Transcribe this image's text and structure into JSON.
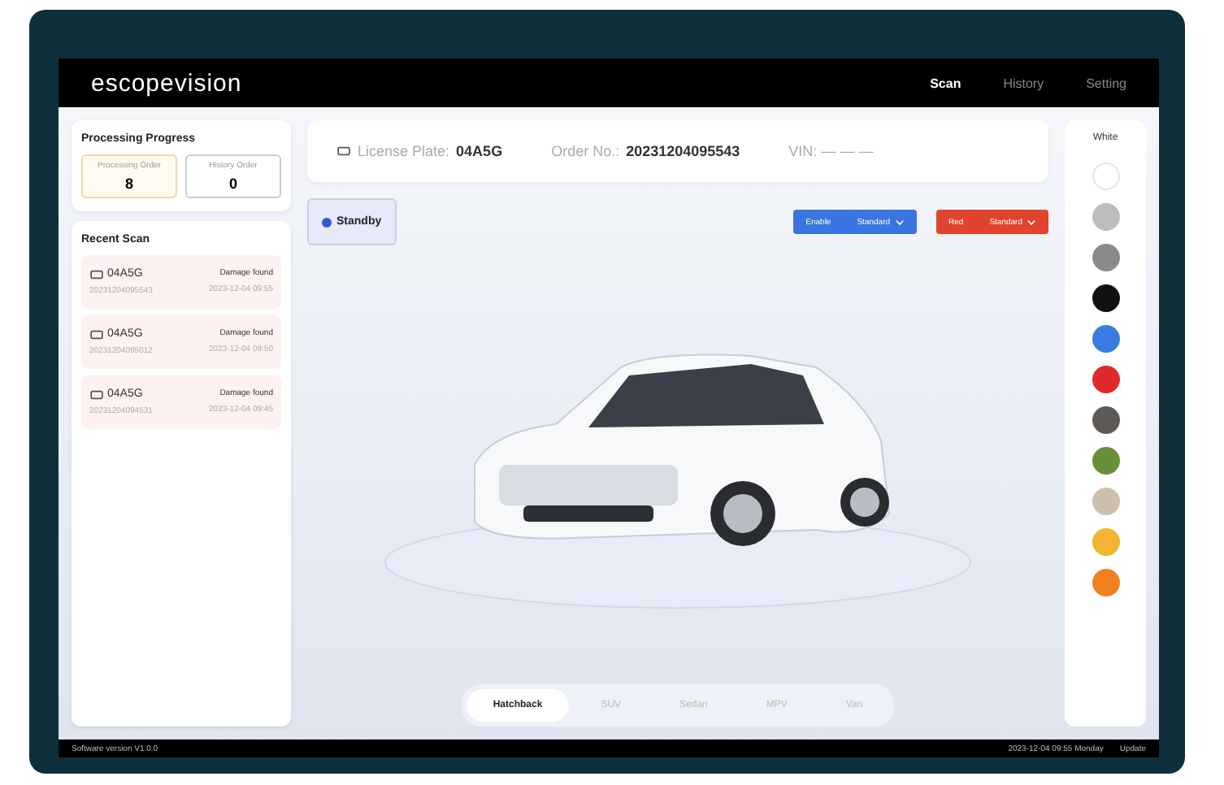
{
  "app": {
    "logo": "escopevision"
  },
  "nav": [
    {
      "label": "Scan",
      "selected": true
    },
    {
      "label": "History",
      "selected": false
    },
    {
      "label": "Setting",
      "selected": false
    }
  ],
  "progress": {
    "title": "Processing Progress",
    "counters": [
      {
        "label": "Processing Order",
        "value": "8",
        "selected": true
      },
      {
        "label": "History Order",
        "value": "0",
        "selected": false
      }
    ]
  },
  "recent": {
    "title": "Recent Scan",
    "items": [
      {
        "plate": "04A5G",
        "order": "20231204095543",
        "status": "Damage found",
        "time": "2023-12-04 09:55"
      },
      {
        "plate": "04A5G",
        "order": "20231204095012",
        "status": "Damage found",
        "time": "2023-12-04 09:50"
      },
      {
        "plate": "04A5G",
        "order": "20231204094531",
        "status": "Damage found",
        "time": "2023-12-04 09:45"
      }
    ]
  },
  "info": {
    "plate_label": "License Plate:",
    "plate": "04A5G",
    "order_label": "Order No.:",
    "order": "20231204095543",
    "vin_label": "VIN:",
    "vin": "— — —"
  },
  "status": {
    "label": "Standby"
  },
  "actions": [
    {
      "label": "Enable",
      "option": "Standard",
      "kind": "primary"
    },
    {
      "label": "Red",
      "option": "Standard",
      "kind": "danger"
    }
  ],
  "body_types": [
    {
      "label": "Hatchback",
      "selected": true
    },
    {
      "label": "SUV",
      "selected": false
    },
    {
      "label": "Sedan",
      "selected": false
    },
    {
      "label": "MPV",
      "selected": false
    },
    {
      "label": "Van",
      "selected": false
    }
  ],
  "colors": {
    "title": "White",
    "items": [
      {
        "color": "#ffffff",
        "selected": true
      },
      {
        "color": "#bdbdbd",
        "selected": false
      },
      {
        "color": "#8a8a8a",
        "selected": false
      },
      {
        "color": "#111111",
        "selected": false
      },
      {
        "color": "#3a7be0",
        "selected": false
      },
      {
        "color": "#e02a2a",
        "selected": false
      },
      {
        "color": "#5e5a58",
        "selected": false
      },
      {
        "color": "#6a8f3a",
        "selected": false
      },
      {
        "color": "#cdbfae",
        "selected": false
      },
      {
        "color": "#f2b531",
        "selected": false
      },
      {
        "color": "#f08020",
        "selected": false
      }
    ]
  },
  "footer": {
    "version": "Software version V1.0.0",
    "datetime": "2023-12-04 09:55 Monday",
    "update": "Update"
  }
}
